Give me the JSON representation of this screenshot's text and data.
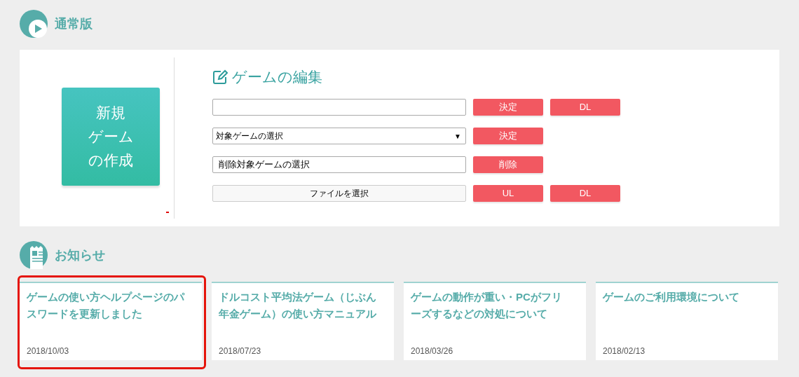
{
  "section_title": "通常版",
  "create_button": {
    "lines": [
      "新規",
      "ゲーム",
      "の作成"
    ]
  },
  "editor": {
    "title": "ゲームの編集",
    "rows": [
      {
        "kind": "text",
        "value": "",
        "buttons": [
          "決定",
          "DL"
        ]
      },
      {
        "kind": "select",
        "value": "対象ゲームの選択",
        "arrow": "▼",
        "buttons": [
          "決定"
        ]
      },
      {
        "kind": "text",
        "value": "削除対象ゲームの選択",
        "buttons": [
          "削除"
        ]
      },
      {
        "kind": "file",
        "value": "ファイルを選択",
        "buttons": [
          "UL",
          "DL"
        ]
      }
    ]
  },
  "news_title": "お知らせ",
  "news": [
    {
      "title": "ゲームの使い方ヘルプページのパスワードを更新しました",
      "date": "2018/10/03",
      "highlighted": true
    },
    {
      "title": "ドルコスト平均法ゲーム（じぶん年金ゲーム）の使い方マニュアル",
      "date": "2018/07/23",
      "highlighted": false
    },
    {
      "title": "ゲームの動作が重い・PCがフリーズするなどの対処について",
      "date": "2018/03/26",
      "highlighted": false
    },
    {
      "title": "ゲームのご利用環境について",
      "date": "2018/02/13",
      "highlighted": false
    }
  ]
}
